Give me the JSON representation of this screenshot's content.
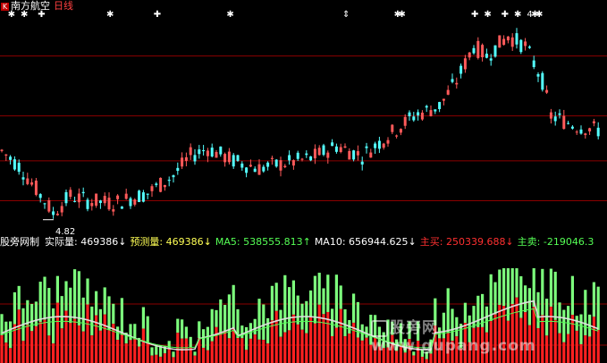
{
  "header": {
    "stock_name": "南方航空",
    "period": "日线",
    "logo_glyph": "K"
  },
  "price_chart": {
    "low_label": "4.82",
    "low_value": 4.82,
    "ylim": [
      4.6,
      8.9
    ],
    "gridlines": [
      5.2,
      6.0,
      6.9,
      8.1
    ],
    "colors": {
      "up": "#ff5a5a",
      "down": "#54ffff",
      "grid": "#8b0000"
    },
    "marker_icon": "asterisk-marker-icon",
    "markers": [
      {
        "day": 2,
        "symbol": "✱"
      },
      {
        "day": 5,
        "symbol": "✱"
      },
      {
        "day": 9,
        "symbol": "✚"
      },
      {
        "day": 25,
        "symbol": "✱"
      },
      {
        "day": 36,
        "symbol": "✚"
      },
      {
        "day": 53,
        "symbol": "✱"
      },
      {
        "day": 80,
        "symbol": "⇕"
      },
      {
        "day": 92,
        "symbol": "✱"
      },
      {
        "day": 93,
        "symbol": "✱"
      },
      {
        "day": 110,
        "symbol": "✚"
      },
      {
        "day": 113,
        "symbol": "✱"
      },
      {
        "day": 117,
        "symbol": "✚"
      },
      {
        "day": 120,
        "symbol": "✱"
      },
      {
        "day": 123,
        "symbol": "4"
      },
      {
        "day": 124,
        "symbol": "✱"
      },
      {
        "day": 125,
        "symbol": "✱"
      }
    ]
  },
  "indicator": {
    "title": "股旁网制",
    "items": [
      {
        "label": "实际量:",
        "value": "469386↓",
        "color": "#ffffff"
      },
      {
        "label": "预测量:",
        "value": "469386↓",
        "color": "#ffff55"
      },
      {
        "label": "MA5:",
        "value": "538555.813↑",
        "color": "#55ff55"
      },
      {
        "label": "MA10:",
        "value": "656944.625↓",
        "color": "#ffffff"
      },
      {
        "label": "主买:",
        "value": "250339.688↓",
        "color": "#ff3030"
      },
      {
        "label": "主卖:",
        "value": "-219046.3",
        "color": "#55ff55"
      }
    ],
    "colors": {
      "red_bar": "#ff2020",
      "green_bar": "#7dff7d",
      "ma_white": "#dddddd",
      "ma_green": "#55ff55",
      "line_red": "#ff0000"
    }
  },
  "watermark": {
    "text": "股旁网 www.gupang.com"
  }
}
